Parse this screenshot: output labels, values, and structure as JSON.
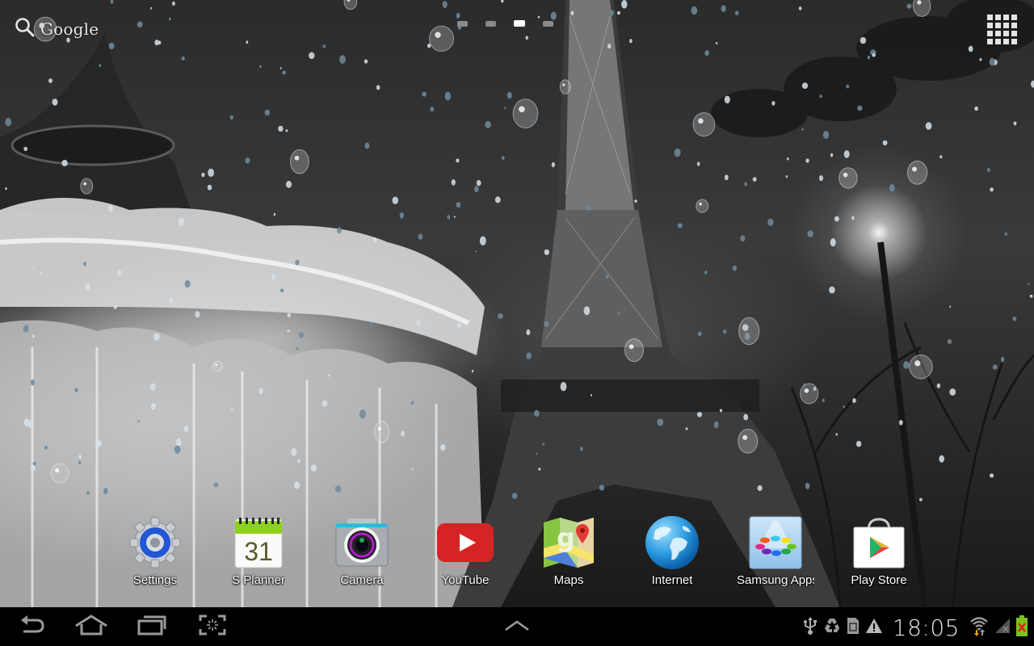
{
  "home": {
    "search": {
      "label": "Google",
      "icon": "search-icon"
    },
    "page_indicator": {
      "count": 4,
      "active_index": 2
    },
    "apps_button": {
      "icon": "apps-grid-icon"
    },
    "shortcuts": [
      {
        "label": "Settings",
        "icon": "settings-gear-icon"
      },
      {
        "label": "S Planner",
        "icon": "calendar-icon",
        "date": "31"
      },
      {
        "label": "Camera",
        "icon": "camera-icon"
      },
      {
        "label": "YouTube",
        "icon": "youtube-icon"
      },
      {
        "label": "Maps",
        "icon": "maps-icon"
      },
      {
        "label": "Internet",
        "icon": "globe-icon"
      },
      {
        "label": "Samsung Apps",
        "icon": "samsung-apps-icon"
      },
      {
        "label": "Play Store",
        "icon": "play-store-icon"
      }
    ]
  },
  "navbar": {
    "buttons": [
      {
        "name": "back",
        "icon": "back-icon"
      },
      {
        "name": "home",
        "icon": "home-icon"
      },
      {
        "name": "recent-apps",
        "icon": "recent-apps-icon"
      },
      {
        "name": "screenshot",
        "icon": "screen-capture-icon"
      },
      {
        "name": "mini-apps",
        "icon": "chevron-up-icon"
      }
    ],
    "status": {
      "notifications": [
        "usb-icon",
        "recycle-icon",
        "sd-card-icon",
        "warning-icon"
      ],
      "time": "18:05",
      "wifi": "wifi-icon",
      "signal": "no-signal-icon",
      "battery": "battery-charging-error-icon"
    }
  },
  "colors": {
    "nav_bg": "#000000",
    "icon_gray": "#9a9a9a",
    "label_text": "#ffffff",
    "youtube_red": "#d62424",
    "calendar_green": "#8cd21c",
    "settings_blue": "#2356d4",
    "battery_green": "#7cc41a",
    "battery_x": "#e02020",
    "wifi_arrow_orange": "#f0a020"
  }
}
